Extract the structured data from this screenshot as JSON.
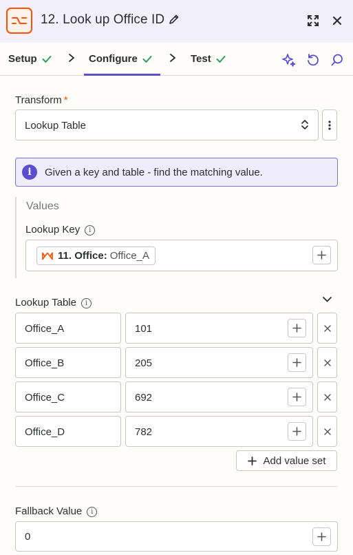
{
  "header": {
    "title": "12. Look up Office ID",
    "icons": [
      "formatter-app-icon",
      "pencil-icon",
      "expand-icon",
      "close-icon"
    ]
  },
  "tabs": [
    {
      "label": "Setup",
      "status": "complete"
    },
    {
      "label": "Configure",
      "status": "complete",
      "active": true
    },
    {
      "label": "Test",
      "status": "complete"
    }
  ],
  "colors": {
    "accent": "#5a4fcf",
    "brand": "#ff4f00",
    "check": "#2e9e5b"
  },
  "form": {
    "transform_label": "Transform",
    "required_mark": "*",
    "transform_value": "Lookup Table",
    "info_text": "Given a key and table - find the matching value.",
    "values_title": "Values",
    "lookup_key_label": "Lookup Key",
    "lookup_key_pill": {
      "step": "11. Office:",
      "value": "Office_A"
    },
    "lookup_table_label": "Lookup Table",
    "rows": [
      {
        "key": "Office_A",
        "value": "101"
      },
      {
        "key": "Office_B",
        "value": "205"
      },
      {
        "key": "Office_C",
        "value": "692"
      },
      {
        "key": "Office_D",
        "value": "782"
      }
    ],
    "add_value_set": "Add value set",
    "fallback_label": "Fallback Value",
    "fallback_value": "0"
  }
}
